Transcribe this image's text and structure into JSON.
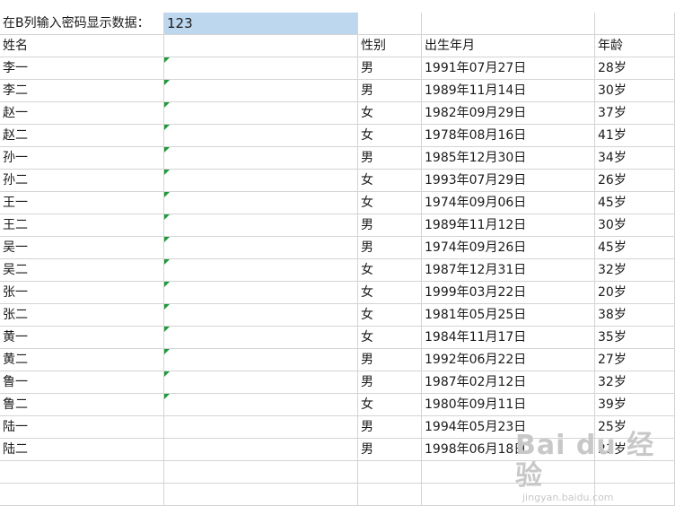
{
  "prompt": {
    "label": "在B列输入密码显示数据：",
    "password": "123"
  },
  "headers": [
    "姓名",
    "",
    "性别",
    "出生年月",
    "年龄"
  ],
  "rows": [
    [
      "李一",
      "男",
      "1991年07月27日",
      "28岁"
    ],
    [
      "李二",
      "男",
      "1989年11月14日",
      "30岁"
    ],
    [
      "赵一",
      "女",
      "1982年09月29日",
      "37岁"
    ],
    [
      "赵二",
      "女",
      "1978年08月16日",
      "41岁"
    ],
    [
      "孙一",
      "男",
      "1985年12月30日",
      "34岁"
    ],
    [
      "孙二",
      "女",
      "1993年07月29日",
      "26岁"
    ],
    [
      "王一",
      "女",
      "1974年09月06日",
      "45岁"
    ],
    [
      "王二",
      "男",
      "1989年11月12日",
      "30岁"
    ],
    [
      "吴一",
      "男",
      "1974年09月26日",
      "45岁"
    ],
    [
      "吴二",
      "女",
      "1987年12月31日",
      "32岁"
    ],
    [
      "张一",
      "女",
      "1999年03月22日",
      "20岁"
    ],
    [
      "张二",
      "女",
      "1981年05月25日",
      "38岁"
    ],
    [
      "黄一",
      "女",
      "1984年11月17日",
      "35岁"
    ],
    [
      "黄二",
      "男",
      "1992年06月22日",
      "27岁"
    ],
    [
      "鲁一",
      "男",
      "1987年02月12日",
      "32岁"
    ],
    [
      "鲁二",
      "女",
      "1980年09月11日",
      "39岁"
    ],
    [
      "陆一",
      "男",
      "1994年05月23日",
      "25岁"
    ],
    [
      "陆二",
      "男",
      "1998年06月18日",
      "21岁"
    ]
  ],
  "watermark": {
    "logo": "Bai du 经验",
    "url": "jingyan.baidu.com"
  }
}
